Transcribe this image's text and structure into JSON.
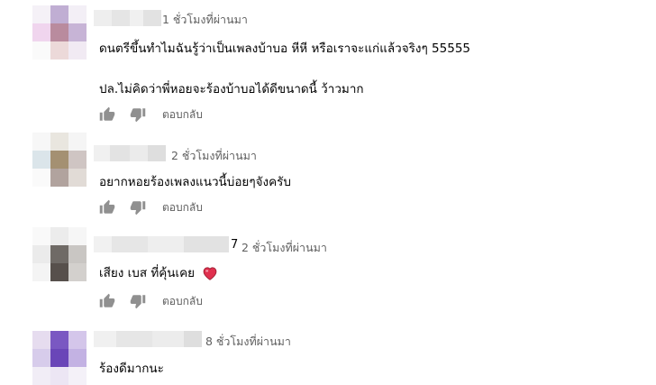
{
  "comments": [
    {
      "time": "1 ชั่วโมงที่ผ่านมา",
      "lines": [
        "ดนตรีขึ้นทำไมฉันรู้ว่าเป็นเพลงบ้าบอ หีหี หรือเราจะแก่แล้วจริงๆ 55555",
        "ปล.ไม่คิดว่าพี่หอยจะร้องบ้าบอได้ดีขนาดนี้ ว้าวมาก"
      ],
      "reply_label": "ตอบกลับ"
    },
    {
      "time": "2 ชั่วโมงที่ผ่านมา",
      "lines": [
        "อยากหอยร้องเพลงแนวนี้บ่อยๆจังครับ"
      ],
      "reply_label": "ตอบกลับ"
    },
    {
      "name_suffix": "7",
      "time": "2 ชั่วโมงที่ผ่านมา",
      "lines": [
        "เสียง เบส ที่คุ้นเคย"
      ],
      "emoji": "heart-emoji",
      "reply_label": "ตอบกลับ"
    },
    {
      "time": "8 ชั่วโมงที่ผ่านมา",
      "lines": [
        "ร้องดีมากนะ"
      ]
    }
  ],
  "icons": {
    "like": "thumb-up-icon",
    "dislike": "thumb-down-icon"
  },
  "colors": {
    "text": "#030303",
    "secondary": "#606060",
    "icon": "#909090",
    "heart": "#e0304e"
  }
}
